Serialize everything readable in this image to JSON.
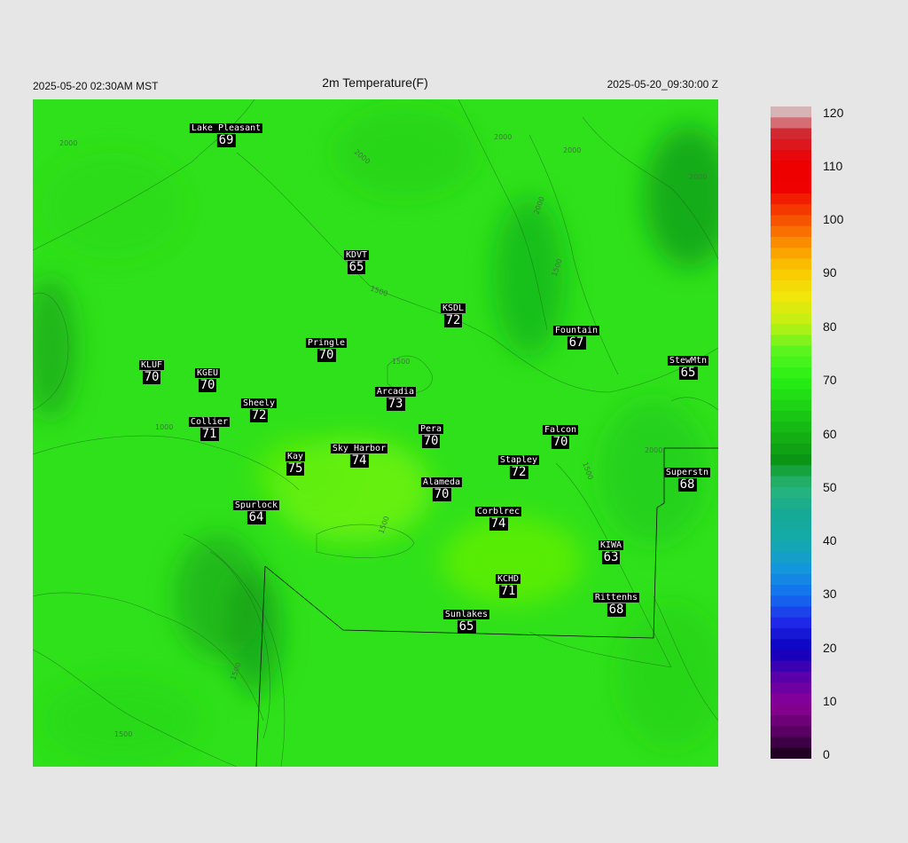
{
  "header": {
    "left": "2025-05-20 02:30AM MST",
    "center": "2m Temperature(F)",
    "right": "2025-05-20_09:30:00 Z"
  },
  "stations": [
    {
      "name": "Lake Pleasant",
      "value": "69",
      "temp": 69
    },
    {
      "name": "KDVT",
      "value": "65",
      "temp": 65
    },
    {
      "name": "KSDL",
      "value": "72",
      "temp": 72
    },
    {
      "name": "Fountain",
      "value": "67",
      "temp": 67
    },
    {
      "name": "StewMtn",
      "value": "65",
      "temp": 65
    },
    {
      "name": "Pringle",
      "value": "70",
      "temp": 70
    },
    {
      "name": "KLUF",
      "value": "70",
      "temp": 70
    },
    {
      "name": "KGEU",
      "value": "70",
      "temp": 70
    },
    {
      "name": "Arcadia",
      "value": "73",
      "temp": 73
    },
    {
      "name": "Sheely",
      "value": "72",
      "temp": 72
    },
    {
      "name": "Collier",
      "value": "71",
      "temp": 71
    },
    {
      "name": "Pera",
      "value": "70",
      "temp": 70
    },
    {
      "name": "Falcon",
      "value": "70",
      "temp": 70
    },
    {
      "name": "Kay",
      "value": "75",
      "temp": 75
    },
    {
      "name": "Sky Harbor",
      "value": "74",
      "temp": 74
    },
    {
      "name": "Stapley",
      "value": "72",
      "temp": 72
    },
    {
      "name": "Superstn",
      "value": "68",
      "temp": 68
    },
    {
      "name": "Alameda",
      "value": "70",
      "temp": 70
    },
    {
      "name": "Spurlock",
      "value": "64",
      "temp": 64
    },
    {
      "name": "Corblrec",
      "value": "74",
      "temp": 74
    },
    {
      "name": "KIWA",
      "value": "63",
      "temp": 63
    },
    {
      "name": "KCHD",
      "value": "71",
      "temp": 71
    },
    {
      "name": "Rittenhs",
      "value": "68",
      "temp": 68
    },
    {
      "name": "Sunlakes",
      "value": "65",
      "temp": 65
    }
  ],
  "contour_labels": [
    "2000",
    "2000",
    "2000",
    "2000",
    "2000",
    "2000",
    "1500",
    "1500",
    "1500",
    "1500",
    "1500",
    "1000",
    "2000",
    "1500",
    "1500"
  ],
  "colorbar": {
    "ticks": [
      "120",
      "110",
      "100",
      "90",
      "80",
      "70",
      "60",
      "50",
      "40",
      "30",
      "20",
      "10",
      "0"
    ],
    "min": 0,
    "max": 120
  }
}
